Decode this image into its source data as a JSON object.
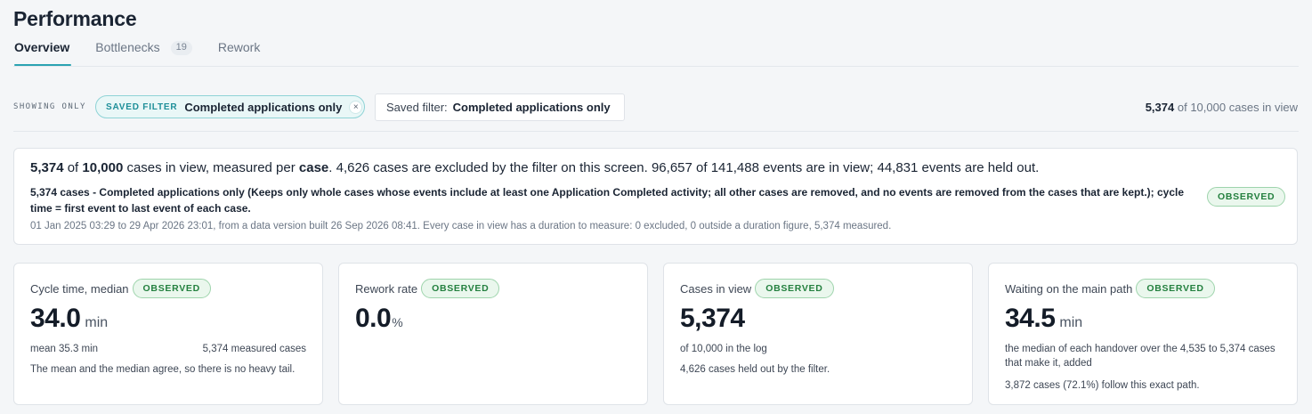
{
  "page": {
    "title": "Performance"
  },
  "tabs": [
    {
      "label": "Overview",
      "active": true
    },
    {
      "label": "Bottlenecks",
      "count": "19"
    },
    {
      "label": "Rework"
    }
  ],
  "filter_bar": {
    "showing_only": "SHOWING ONLY",
    "chip_kicker": "SAVED FILTER",
    "chip_value": "Completed applications only",
    "chip_close": "×",
    "saved_label": "Saved filter:",
    "saved_value": "Completed applications only",
    "cases_count": "5,374",
    "cases_rest": " of 10,000 cases in view"
  },
  "summary": {
    "line1": {
      "in_view": "5,374",
      "of": " of ",
      "total": "10,000",
      "mid": " cases in view, measured per ",
      "unit": "case",
      "rest": ". 4,626 cases are excluded by the filter on this screen. 96,657 of 141,488 events are in view; 44,831 events are held out."
    },
    "line2": "5,374 cases - Completed applications only (Keeps only whole cases whose events include at least one Application Completed activity; all other cases are removed, and no events are removed from the cases that are kept.); cycle time = first event to last event of each case.",
    "line3": "01 Jan 2025 03:29 to 29 Apr 2026 23:01, from a data version built 26 Sep 2026 08:41. Every case in view has a duration to measure: 0 excluded, 0 outside a duration figure, 5,374 measured.",
    "badge": "OBSERVED"
  },
  "kpis": {
    "cycle": {
      "label": "Cycle time, median",
      "badge": "OBSERVED",
      "value": "34.0",
      "unit": "min",
      "mean": "mean 35.3 min",
      "measured": "5,374 measured cases",
      "note": "The mean and the median agree, so there is no heavy tail."
    },
    "rework": {
      "label": "Rework rate",
      "badge": "OBSERVED",
      "value": "0.0",
      "unit": "%"
    },
    "cases": {
      "label": "Cases in view",
      "badge": "OBSERVED",
      "value": "5,374",
      "sub": "of 10,000 in the log",
      "note": "4,626 cases held out by the filter."
    },
    "waiting": {
      "label": "Waiting on the main path",
      "badge": "OBSERVED",
      "value": "34.5",
      "unit": "min",
      "sub": "the median of each handover over the 4,535 to 5,374 cases that make it, added",
      "note": "3,872 cases (72.1%) follow this exact path."
    }
  }
}
